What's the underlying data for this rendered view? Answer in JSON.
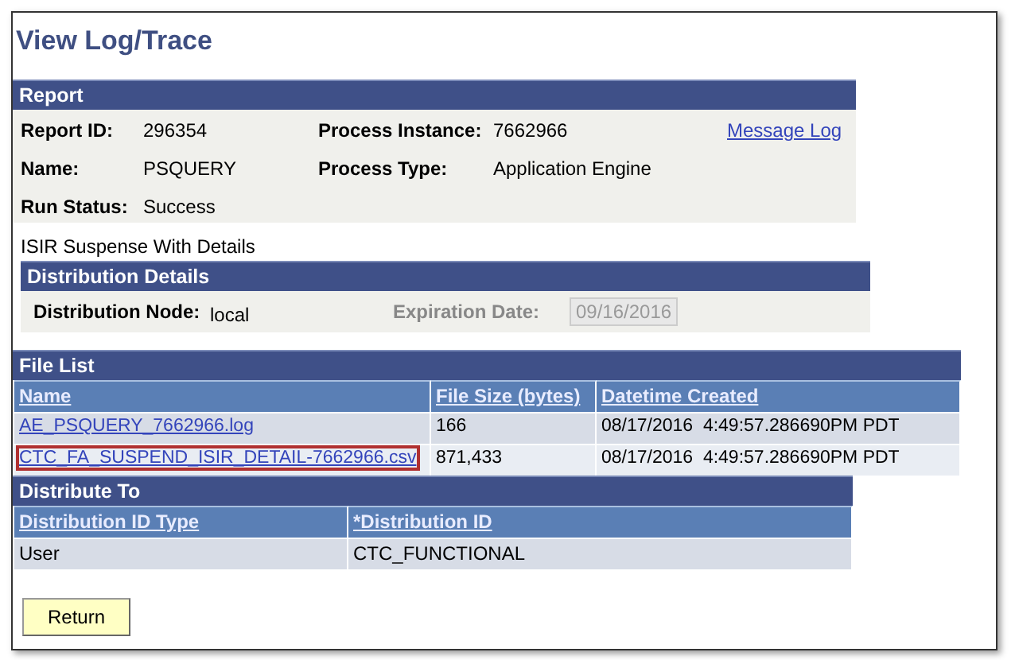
{
  "page_title": "View Log/Trace",
  "report": {
    "header": "Report",
    "fields": [
      {
        "label": "Report ID:",
        "value": "296354"
      },
      {
        "label": "Process Instance:",
        "value": "7662966"
      },
      {
        "label": "Name:",
        "value": "PSQUERY"
      },
      {
        "label": "Process Type:",
        "value": "Application Engine"
      },
      {
        "label": "Run Status:",
        "value": "Success"
      }
    ],
    "message_log_link": "Message Log"
  },
  "description": "ISIR Suspense With Details",
  "distribution_details": {
    "header": "Distribution Details",
    "node_label": "Distribution Node:",
    "node_value": "local",
    "expiration_label": "Expiration Date:",
    "expiration_value": "09/16/2016",
    "expiration_disabled": true
  },
  "file_list": {
    "header": "File List",
    "columns": [
      "Name",
      "File Size (bytes)",
      "Datetime Created"
    ],
    "rows": [
      {
        "name": "AE_PSQUERY_7662966.log",
        "size": "166",
        "created": "08/17/2016  4:49:57.286690PM PDT",
        "highlighted": false
      },
      {
        "name": "CTC_FA_SUSPEND_ISIR_DETAIL-7662966.csv",
        "size": "871,433",
        "created": "08/17/2016  4:49:57.286690PM PDT",
        "highlighted": true
      }
    ]
  },
  "distribute_to": {
    "header": "Distribute To",
    "columns": [
      "Distribution ID Type",
      "*Distribution ID"
    ],
    "rows": [
      {
        "type": "User",
        "id": "CTC_FUNCTIONAL"
      }
    ]
  },
  "buttons": [
    "Return"
  ]
}
